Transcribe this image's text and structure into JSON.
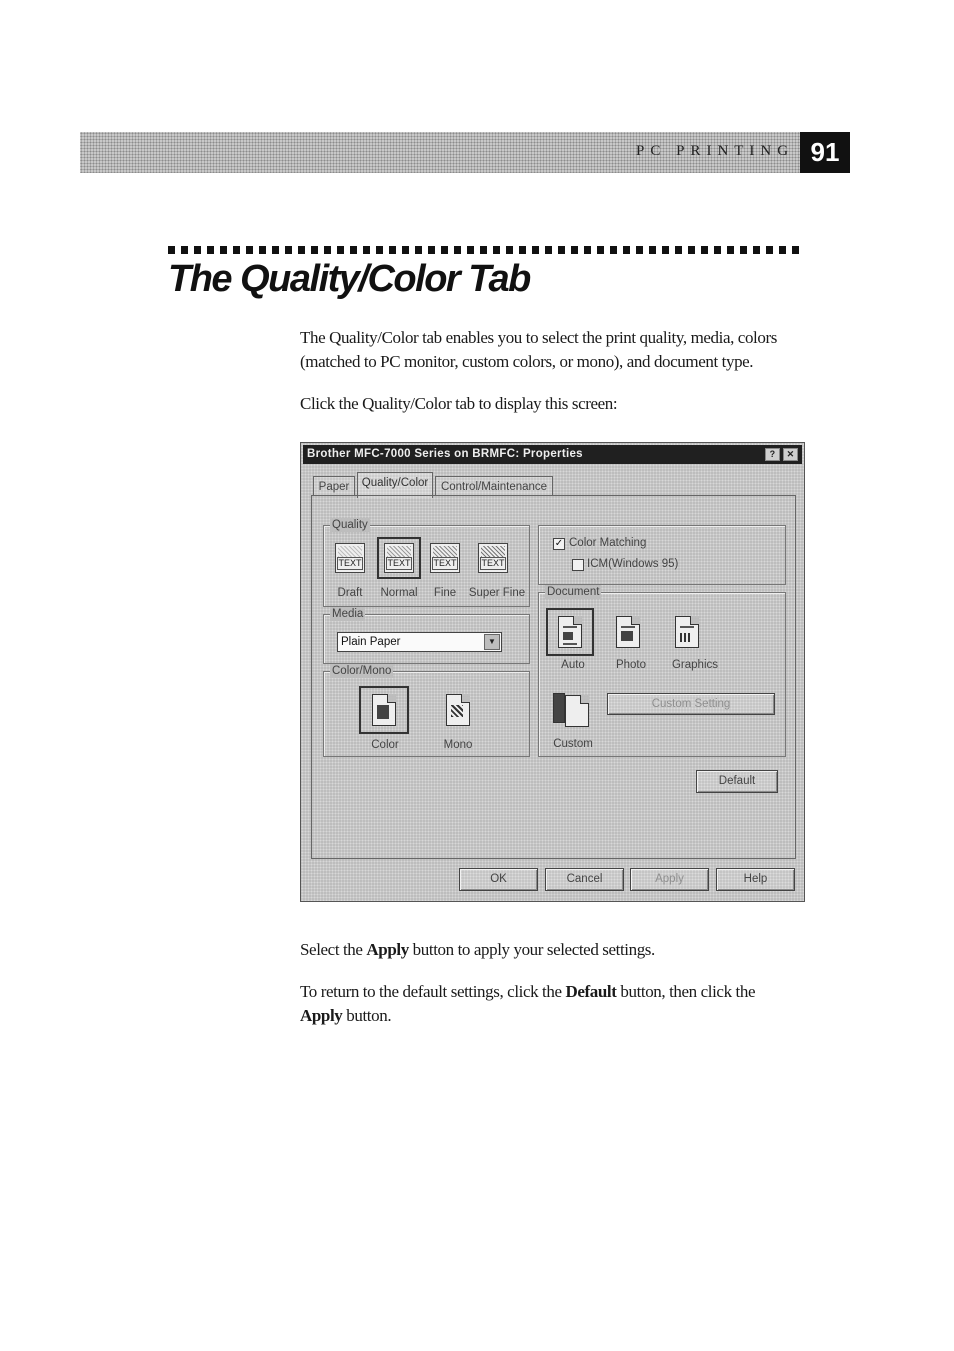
{
  "header": {
    "section": "PC PRINTING",
    "page_number": "91"
  },
  "page_title": "The Quality/Color Tab",
  "paragraphs": {
    "intro": "The Quality/Color tab enables you to select the print quality, media, colors (matched to PC monitor, custom colors, or mono), and document type.",
    "click": "Click the Quality/Color tab to display this screen:",
    "apply": {
      "pre": "Select the ",
      "bold": "Apply",
      "post": " button to apply your selected settings."
    },
    "default": {
      "pre": "To return to the default settings, click the ",
      "bold1": "Default",
      "mid": " button, then click the ",
      "bold2": "Apply",
      "post": " button."
    }
  },
  "dialog": {
    "title": "Brother MFC-7000 Series on BRMFC: Properties",
    "help_btn": "?",
    "close_btn": "✕",
    "tabs": [
      "Paper",
      "Quality/Color",
      "Control/Maintenance"
    ],
    "quality": {
      "label": "Quality",
      "icon_text": "TEXT",
      "options": [
        "Draft",
        "Normal",
        "Fine",
        "Super Fine"
      ],
      "selected": "Normal"
    },
    "color_matching": {
      "checkbox_label": "Color Matching",
      "checked": true,
      "icm_label": "ICM(Windows 95)",
      "icm_checked": false
    },
    "media": {
      "label": "Media",
      "selected": "Plain Paper"
    },
    "document": {
      "label": "Document",
      "options": [
        "Auto",
        "Photo",
        "Graphics"
      ],
      "selected": "Auto",
      "custom_label": "Custom",
      "custom_setting_button": "Custom Setting"
    },
    "color_mono": {
      "label": "Color/Mono",
      "options": [
        "Color",
        "Mono"
      ],
      "selected": "Color"
    },
    "buttons": {
      "default": "Default",
      "ok": "OK",
      "cancel": "Cancel",
      "apply": "Apply",
      "help": "Help"
    },
    "check_glyph": "✓",
    "dropdown_arrow": "▼"
  }
}
